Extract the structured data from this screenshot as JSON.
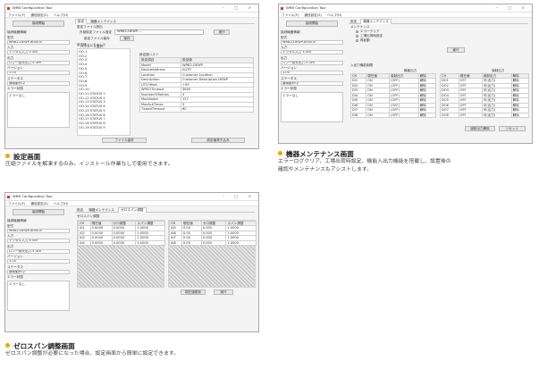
{
  "window": {
    "title": "WRB Configuration Tool",
    "controls": "–  □  ×",
    "menu": [
      "ファイル(F)",
      "通信設定(S)",
      "ヘルプ(H)"
    ]
  },
  "left_panel": {
    "connect_button": "接続開始",
    "device_header": "接続機器情報",
    "model_label": "型式",
    "model_value": "WRB2-DEWP-8000-B",
    "input_label": "入力",
    "input_value": "デジタル入力 x 4ch",
    "output_label": "出力",
    "output_value": "ロン一発光出力 x 4ch",
    "version_label": "バージョン",
    "version_value": "1.00",
    "status_label": "ステータス",
    "status_value": "通常動作中",
    "error_label": "エラー状態",
    "error_value": "エラーなし",
    "error_value_short": "エラーなし"
  },
  "settings_screen": {
    "tabs": [
      "設定",
      "機器メンテナンス"
    ],
    "file_group": "設定ファイル読出",
    "file_row_label": "外部設定ファイル指定",
    "file_select": "WRB2-DEWP-...",
    "run_button": "実行",
    "save_label": "設定ファイル保存",
    "save_button": "保存",
    "maint_group": "設定値メンテナンス",
    "param_label": "パラメータ選択",
    "list_items": [
      "OO-1",
      "OO-2",
      "OO-3",
      "OO-4",
      "OO-5",
      "OO-6",
      "OO-7",
      "OO-8",
      "OO-9",
      "OO-10",
      "OO-11 STATUS 1",
      "OO-12 STATUS 2",
      "OO-13 STATUS 3",
      "OO-14 STATUS 4",
      "OO-15 STATUS 5",
      "OO-16 STATUS 6",
      "OO-17 STATUS 7",
      "OO-18 STATUS 8",
      "OO-19 STATUS 9"
    ],
    "grid_title": "設定値リスト",
    "grid_headers": [
      "設定項目",
      "設定値"
    ],
    "grid_rows": [
      [
        "Model",
        "WRB2-DEWP"
      ],
      [
        "DeviceAddress",
        "AUTO"
      ],
      [
        "Location",
        "Customer Location"
      ],
      [
        "Description",
        "Customer Description DEWP"
      ],
      [
        "UTCOffset",
        "+09"
      ],
      [
        "WRSOTimeout",
        "3600"
      ],
      [
        "NumberOfRetries",
        "3"
      ],
      [
        "MaxWaiter",
        "127"
      ],
      [
        "MaxAckTimes",
        "3"
      ],
      [
        "TxwaitTimeout",
        "60"
      ]
    ],
    "read_button": "ファイル保存",
    "write_button": "設定値書き込み"
  },
  "maintenance_screen": {
    "tabs": [
      "設定",
      "機器メンテナンス"
    ],
    "group_title": "メンテナンス",
    "radio_options": [
      "エラークリア",
      "工場出荷時設定",
      "再起動"
    ],
    "run_button": "実行",
    "io_title": "入出力機能制限",
    "sub_headers": [
      "機能出力",
      "強制出力"
    ],
    "table_headers": [
      "CH",
      "現在値",
      "強制出力",
      "解除"
    ],
    "table_left": [
      [
        "DI1",
        "ON",
        "(OFF)"
      ],
      [
        "DI2",
        "ON",
        "(OFF)"
      ],
      [
        "DI3",
        "ON",
        "(OFF)"
      ],
      [
        "DI4",
        "ON",
        "(OFF)"
      ],
      [
        "DI5",
        "ON",
        "(OFF)"
      ],
      [
        "DI6",
        "ON",
        "(OFF)"
      ],
      [
        "DI7",
        "ON",
        "(OFF)"
      ],
      [
        "DI8",
        "ON",
        "(OFF)"
      ]
    ],
    "table_right": [
      [
        "DO1",
        "OFF",
        "可(出力)"
      ],
      [
        "DO2",
        "OFF",
        "可(出力)"
      ],
      [
        "DO3",
        "OFF",
        "可(出力)"
      ],
      [
        "DO4",
        "OFF",
        "可(出力)"
      ],
      [
        "DO5",
        "OFF",
        "可(出力)"
      ],
      [
        "DO6",
        "OFF",
        "可(出力)"
      ],
      [
        "DO7",
        "OFF",
        "可(出力)"
      ],
      [
        "DO8",
        "OFF",
        "可(出力)"
      ]
    ],
    "cell_action": "解除",
    "update_button": "強制出力解除",
    "close_button": "リセット"
  },
  "zerospan_screen": {
    "tabs": [
      "設定",
      "機器メンテナンス",
      "ゼロスパン調整"
    ],
    "group_title": "ゼロスパン調整",
    "table_headers": [
      "CH",
      "現在値",
      "ゼロ調整",
      "スパン調整"
    ],
    "table_left": [
      [
        "AI1",
        "0.0000",
        "0.0000",
        "1.0000"
      ],
      [
        "AI2",
        "0.0000",
        "0.0000",
        "1.0000"
      ],
      [
        "AI3",
        "0.0000",
        "0.0000",
        "1.0000"
      ],
      [
        "AI4",
        "0.0000",
        "0.0000",
        "1.0000"
      ]
    ],
    "table_right": [
      [
        "AI5",
        "0.00",
        "0.000",
        "1.0000"
      ],
      [
        "AI6",
        "0.00",
        "0.000",
        "1.0000"
      ],
      [
        "AI7",
        "0.00",
        "0.000",
        "1.0000"
      ],
      [
        "AI8",
        "0.00",
        "0.000",
        "1.0000"
      ]
    ],
    "update_button": "現在値更新",
    "run_button": "実行"
  },
  "captions": {
    "settings_title": "設定画面",
    "settings_desc": "圧縮ファイルを解凍するのみ。インストール作業なしで使用できます。",
    "maint_title": "機器メンテナンス画面",
    "maint_desc_1": "エラーログクリア、工場出荷時設定、機能入出力機能を搭載し、設置後の",
    "maint_desc_2": "確認やメンテナンスもアシストします。",
    "zero_title": "ゼロスパン調整画面",
    "zero_desc": "ゼロスパン調整が必要になった場合、設定画面から簡単に設定できます。"
  },
  "colors": {
    "bullet": "#f0a500",
    "app_icon": "#c83c2b"
  }
}
